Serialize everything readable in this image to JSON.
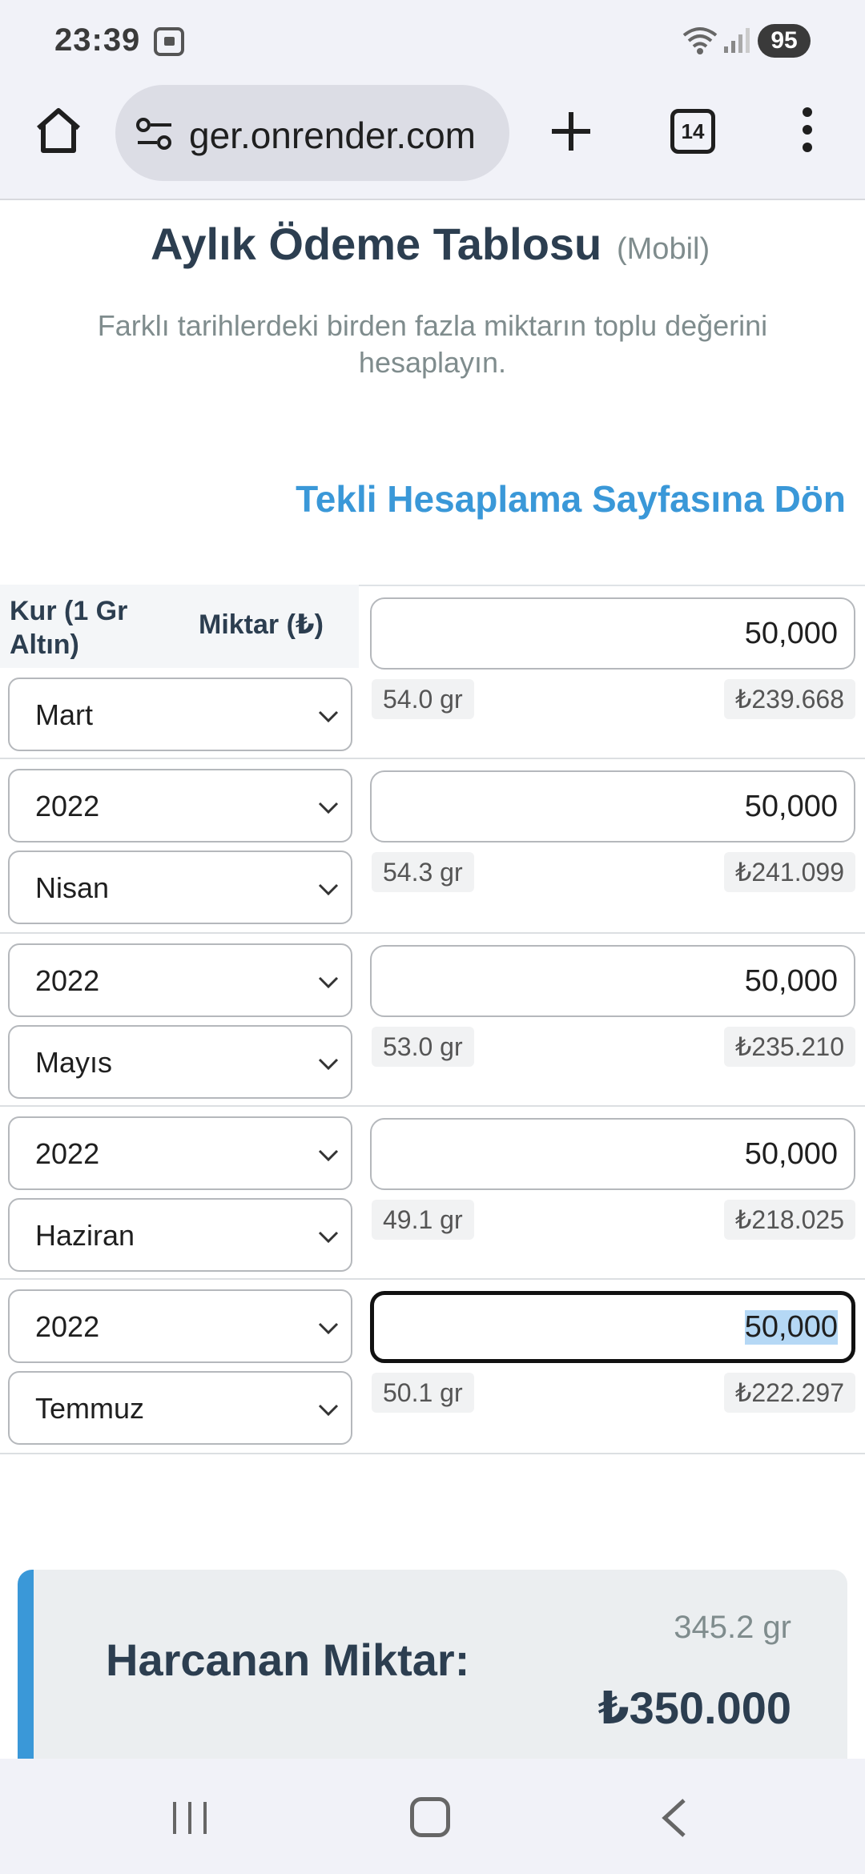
{
  "status_bar": {
    "time": "23:39",
    "battery": "95"
  },
  "browser": {
    "url": "ger.onrender.com",
    "tab_count": "14"
  },
  "page": {
    "title": "Aylık Ödeme Tablosu",
    "title_badge": "(Mobil)",
    "description": "Farklı tarihlerdeki birden fazla miktarın toplu değerini hesaplayın.",
    "back_link": "Tekli Hesaplama Sayfasına Dön"
  },
  "table": {
    "headers": {
      "rate": "Kur (1 Gr Altın)",
      "amount": "Miktar (₺)"
    },
    "rows": [
      {
        "year": "",
        "month": "Mart",
        "amount": "50,000",
        "grams": "54.0 gr",
        "value": "₺239.668"
      },
      {
        "year": "2022",
        "month": "Nisan",
        "amount": "50,000",
        "grams": "54.3 gr",
        "value": "₺241.099"
      },
      {
        "year": "2022",
        "month": "Mayıs",
        "amount": "50,000",
        "grams": "53.0 gr",
        "value": "₺235.210"
      },
      {
        "year": "2022",
        "month": "Haziran",
        "amount": "50,000",
        "grams": "49.1 gr",
        "value": "₺218.025"
      },
      {
        "year": "2022",
        "month": "Temmuz",
        "amount": "50,000",
        "grams": "50.1 gr",
        "value": "₺222.297"
      }
    ]
  },
  "summary": {
    "label": "Harcanan Miktar:",
    "grams": "345.2 gr",
    "total": "₺350.000"
  },
  "colors": {
    "accent": "#3a98d8",
    "text": "#2c3e50",
    "muted": "#7f8c8d"
  }
}
